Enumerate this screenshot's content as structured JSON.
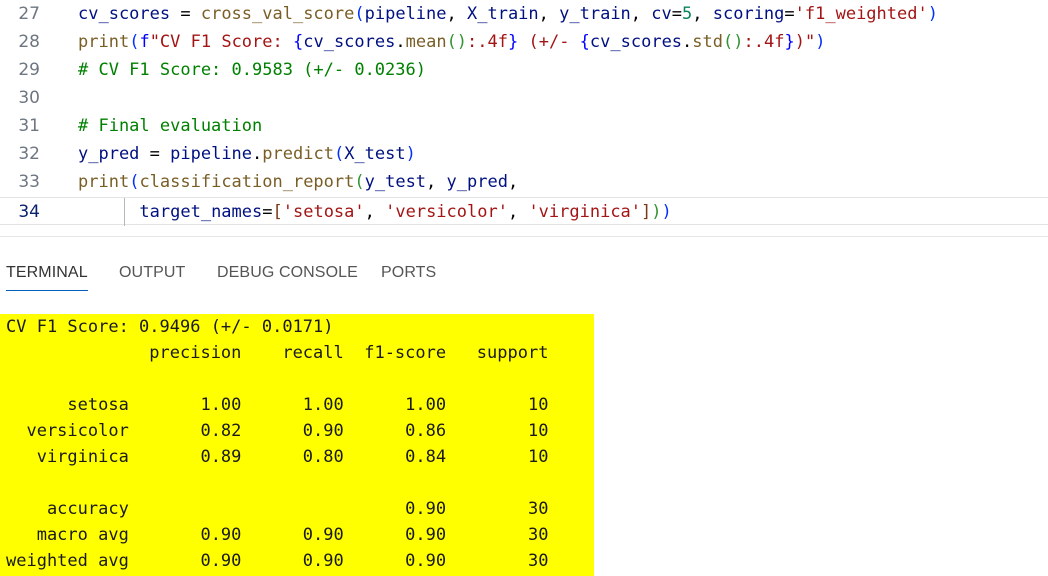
{
  "editor": {
    "lines": [
      {
        "n": "27",
        "tokens": [
          [
            "var",
            "cv_scores"
          ],
          [
            "pun",
            " = "
          ],
          [
            "fn",
            "cross_val_score"
          ],
          [
            "b1",
            "("
          ],
          [
            "var",
            "pipeline"
          ],
          [
            "pun",
            ", "
          ],
          [
            "var",
            "X_train"
          ],
          [
            "pun",
            ", "
          ],
          [
            "var",
            "y_train"
          ],
          [
            "pun",
            ", "
          ],
          [
            "var",
            "cv"
          ],
          [
            "pun",
            "="
          ],
          [
            "num",
            "5"
          ],
          [
            "pun",
            ", "
          ],
          [
            "var",
            "scoring"
          ],
          [
            "pun",
            "="
          ],
          [
            "str",
            "'f1_weighted'"
          ],
          [
            "b1",
            ")"
          ]
        ]
      },
      {
        "n": "28",
        "tokens": [
          [
            "fn",
            "print"
          ],
          [
            "b1",
            "("
          ],
          [
            "brace",
            "f"
          ],
          [
            "str",
            "\"CV F1 Score: "
          ],
          [
            "brace",
            "{"
          ],
          [
            "var",
            "cv_scores"
          ],
          [
            "pun",
            "."
          ],
          [
            "fn",
            "mean"
          ],
          [
            "b2",
            "()"
          ],
          [
            "str",
            ":.4f"
          ],
          [
            "brace",
            "}"
          ],
          [
            "str",
            " (+/- "
          ],
          [
            "brace",
            "{"
          ],
          [
            "var",
            "cv_scores"
          ],
          [
            "pun",
            "."
          ],
          [
            "fn",
            "std"
          ],
          [
            "b2",
            "()"
          ],
          [
            "str",
            ":.4f"
          ],
          [
            "brace",
            "}"
          ],
          [
            "str",
            ")\""
          ],
          [
            "b1",
            ")"
          ]
        ]
      },
      {
        "n": "29",
        "tokens": [
          [
            "cmt",
            "# CV F1 Score: 0.9583 (+/- 0.0236)"
          ]
        ]
      },
      {
        "n": "30",
        "tokens": []
      },
      {
        "n": "31",
        "tokens": [
          [
            "cmt",
            "# Final evaluation"
          ]
        ]
      },
      {
        "n": "32",
        "tokens": [
          [
            "var",
            "y_pred"
          ],
          [
            "pun",
            " = "
          ],
          [
            "var",
            "pipeline"
          ],
          [
            "pun",
            "."
          ],
          [
            "fn",
            "predict"
          ],
          [
            "b1",
            "("
          ],
          [
            "var",
            "X_test"
          ],
          [
            "b1",
            ")"
          ]
        ]
      },
      {
        "n": "33",
        "tokens": [
          [
            "fn",
            "print"
          ],
          [
            "b1",
            "("
          ],
          [
            "fn",
            "classification_report"
          ],
          [
            "b2",
            "("
          ],
          [
            "var",
            "y_test"
          ],
          [
            "pun",
            ", "
          ],
          [
            "var",
            "y_pred"
          ],
          [
            "pun",
            ","
          ]
        ]
      },
      {
        "n": "34",
        "active": true,
        "tokens": [
          [
            "pun",
            "      "
          ],
          [
            "var",
            "target_names"
          ],
          [
            "pun",
            "="
          ],
          [
            "b3",
            "["
          ],
          [
            "str",
            "'setosa'"
          ],
          [
            "pun",
            ", "
          ],
          [
            "str",
            "'versicolor'"
          ],
          [
            "pun",
            ", "
          ],
          [
            "str",
            "'virginica'"
          ],
          [
            "b3",
            "]"
          ],
          [
            "b2",
            ")"
          ],
          [
            "b1",
            ")"
          ]
        ]
      }
    ]
  },
  "panel": {
    "tabs": [
      {
        "label": "TERMINAL",
        "active": true
      },
      {
        "label": "OUTPUT"
      },
      {
        "label": "DEBUG CONSOLE"
      },
      {
        "label": "PORTS"
      }
    ]
  },
  "terminal": {
    "highlight_color": "#ffff00",
    "lines": [
      "CV F1 Score: 0.9496 (+/- 0.0171)",
      "              precision    recall  f1-score   support",
      "",
      "      setosa       1.00      1.00      1.00        10",
      "  versicolor       0.82      0.90      0.86        10",
      "   virginica       0.89      0.80      0.84        10",
      "",
      "    accuracy                           0.90        30",
      "   macro avg       0.90      0.90      0.90        30",
      "weighted avg       0.90      0.90      0.90        30"
    ]
  }
}
